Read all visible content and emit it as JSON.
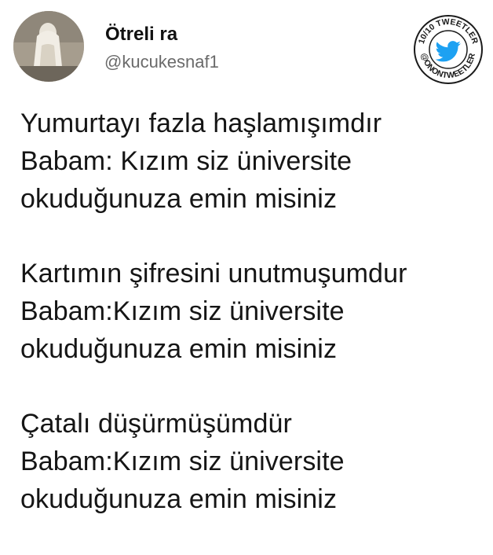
{
  "tweet": {
    "display_name": "Ötreli ra",
    "handle": "@kucukesnaf1",
    "paragraphs": [
      [
        "Yumurtayı fazla haşlamışımdır",
        "Babam: Kızım siz üniversite",
        "okuduğunuza emin misiniz"
      ],
      [
        "Kartımın şifresini unutmuşumdur",
        "Babam:Kızım siz üniversite",
        "okuduğunuza emin misiniz"
      ],
      [
        "Çatalı düşürmüşümdür",
        "Babam:Kızım siz üniversite",
        "okuduğunuza emin misiniz"
      ]
    ]
  },
  "watermark": {
    "top_text": "10/10 TWEETLER",
    "bottom_text": "@ONONTWEETLER",
    "icon": "twitter-bird-icon",
    "bird_color": "#1da1f2"
  }
}
